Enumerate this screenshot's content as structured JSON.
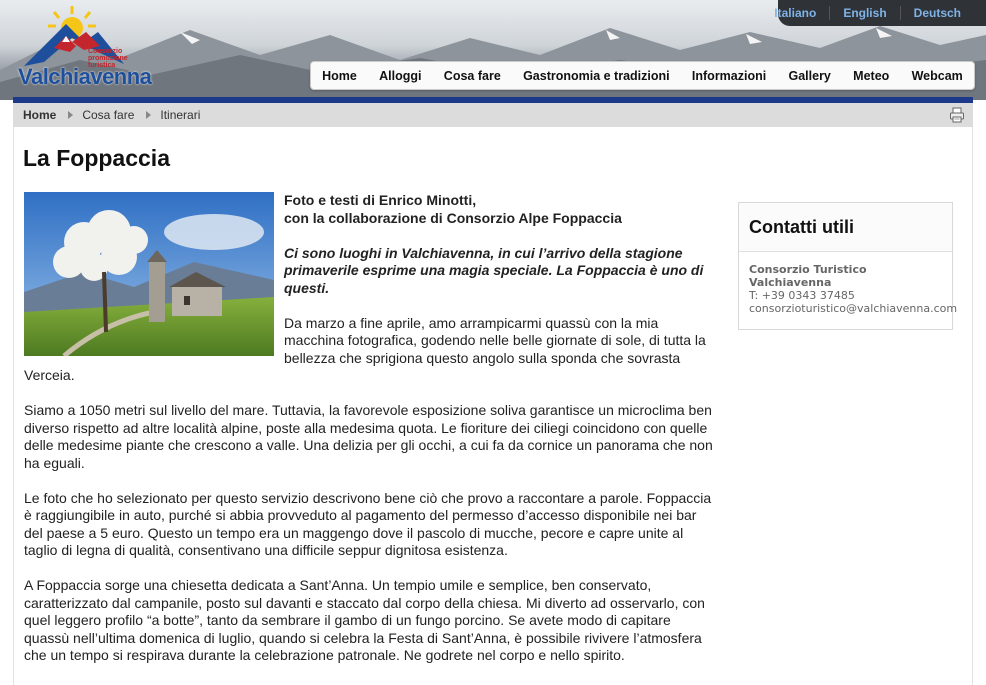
{
  "logo": {
    "brand": "Valchiavenna",
    "subtitle": "Consorzio promozione turistica"
  },
  "languages": [
    {
      "label": "Italiano"
    },
    {
      "label": "English"
    },
    {
      "label": "Deutsch"
    }
  ],
  "nav": {
    "items": [
      "Home",
      "Alloggi",
      "Cosa fare",
      "Gastronomia e tradizioni",
      "Informazioni",
      "Gallery",
      "Meteo",
      "Webcam"
    ]
  },
  "breadcrumb": [
    "Home",
    "Cosa fare",
    "Itinerari"
  ],
  "page": {
    "title": "La Foppaccia"
  },
  "article": {
    "credit_line1": "Foto e testi di Enrico Minotti,",
    "credit_line2": "con la collaborazione di Consorzio Alpe Foppaccia",
    "lead": "Ci sono luoghi in Valchiavenna, in cui l’arrivo della stagione primaverile esprime una magia speciale. La Foppaccia è uno di questi.",
    "p1": "Da marzo a fine aprile, amo arrampicarmi quassù con la mia macchina fotografica, godendo nelle belle giornate di sole, di tutta la bellezza che sprigiona questo angolo sulla sponda che sovrasta Verceia.",
    "p2": "Siamo a 1050 metri sul livello del mare. Tuttavia, la favorevole esposizione soliva garantisce un microclima ben diverso rispetto ad altre località alpine, poste alla medesima quota. Le fioriture dei ciliegi coincidono con quelle delle medesime piante che crescono a valle. Una delizia per gli occhi, a cui fa da cornice un panorama che non ha eguali.",
    "p3": "Le foto che ho selezionato per questo servizio descrivono bene ciò che provo a raccontare a parole. Foppaccia è raggiungibile in auto, purché si abbia provveduto al pagamento del permesso d’accesso disponibile nei bar del paese a 5 euro. Questo un tempo era un maggengo dove il pascolo di mucche, pecore e capre unite al taglio di legna di qualità, consentivano una difficile seppur dignitosa esistenza.",
    "p4": "A Foppaccia sorge una chiesetta dedicata a Sant’Anna. Un tempio umile e semplice, ben conservato, caratterizzato dal campanile, posto sul davanti e staccato dal corpo della chiesa. Mi diverto ad osservarlo, con quel leggero profilo “a botte”, tanto da sembrare il gambo di un fungo porcino. Se avete modo di capitare quassù nell’ultima domenica di luglio, quando si celebra la Festa di Sant’Anna, è possibile rivivere l’atmosfera che un tempo si respirava durante la celebrazione patronale. Ne godrete nel corpo e nello spirito."
  },
  "contacts": {
    "title": "Contatti utili",
    "org_line1": "Consorzio Turistico",
    "org_line2": "Valchiavenna",
    "phone": "T: +39 0343 37485",
    "email": "consorzioturistico@valchiavenna.com"
  },
  "colors": {
    "nav_blue_bar": "#1d3a8a",
    "lang_link": "#7fb3e8",
    "brand_blue": "#1e4f9c",
    "brand_red": "#c4262e"
  }
}
